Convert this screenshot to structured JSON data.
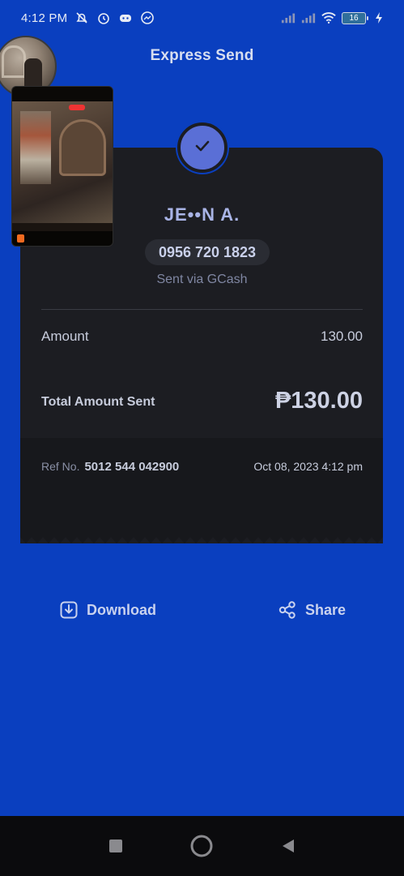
{
  "status_bar": {
    "time": "4:12 PM",
    "battery": "16",
    "icons": [
      "mute-icon",
      "alarm-icon",
      "discord-icon",
      "messenger-icon",
      "signal-icon",
      "signal-icon",
      "wifi-icon",
      "battery-icon",
      "charging-icon"
    ]
  },
  "header": {
    "title": "Express Send"
  },
  "receipt": {
    "recipient_name": "JE••N A.",
    "phone": "0956 720 1823",
    "sent_via": "Sent via GCash",
    "amount_label": "Amount",
    "amount_value": "130.00",
    "total_label": "Total Amount Sent",
    "total_value": "₱130.00",
    "ref_label": "Ref No.",
    "ref_number": "5012 544 042900",
    "date": "Oct 08, 2023 4:12 pm"
  },
  "actions": {
    "download_label": "Download",
    "share_label": "Share"
  },
  "colors": {
    "background": "#0a3fbf",
    "card": "#1c1d22",
    "accent": "#5a6fd6"
  }
}
